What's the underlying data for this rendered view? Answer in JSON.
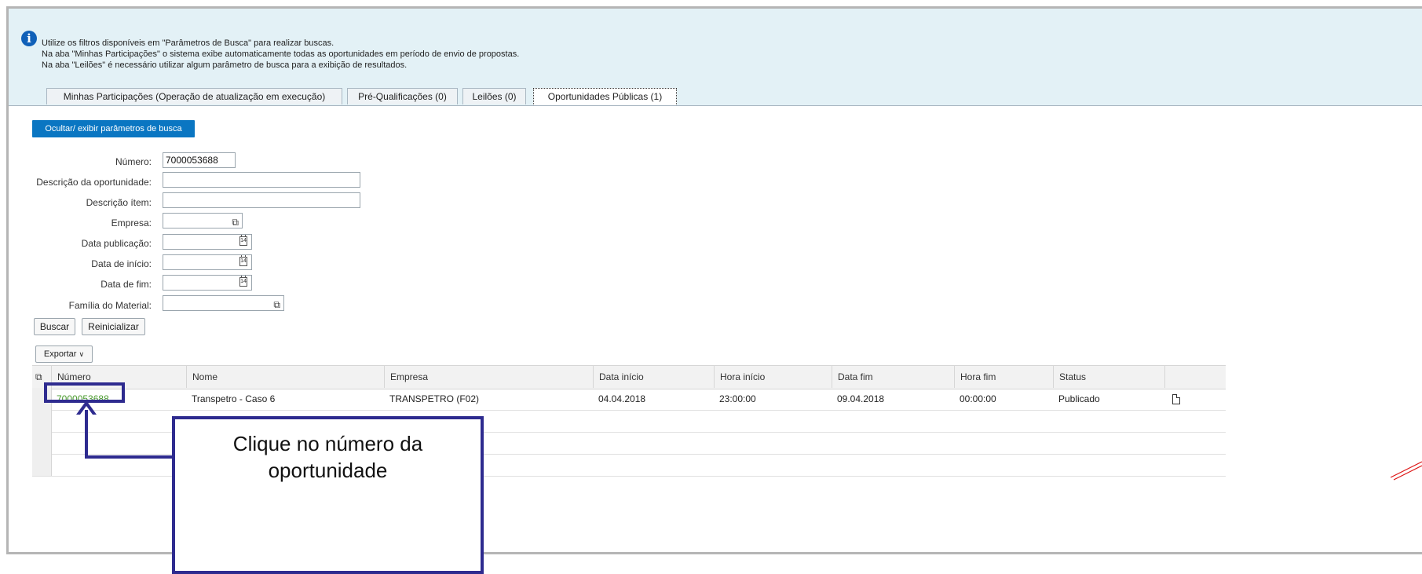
{
  "info": {
    "lines": [
      "Utilize os filtros disponíveis em \"Parâmetros de Busca\" para realizar buscas.",
      "Na aba \"Minhas Participações\" o sistema exibe automaticamente todas as oportunidades em período de envio de propostas.",
      "Na aba \"Leilões\" é necessário utilizar algum parâmetro de busca para a exibição de resultados."
    ]
  },
  "tabs": [
    {
      "label": "Minhas Participações (Operação de atualização em execução)",
      "active": false
    },
    {
      "label": "Pré-Qualificações (0)",
      "active": false
    },
    {
      "label": "Leilões (0)",
      "active": false
    },
    {
      "label": "Oportunidades Públicas (1)",
      "active": true
    }
  ],
  "toggle_button": "Ocultar/ exibir parâmetros de busca",
  "filters": {
    "numero": {
      "label": "Número:",
      "value": "7000053688"
    },
    "descricao_oportunidade": {
      "label": "Descrição da oportunidade:",
      "value": ""
    },
    "descricao_item": {
      "label": "Descrição ítem:",
      "value": ""
    },
    "empresa": {
      "label": "Empresa:",
      "value": "",
      "icon": "value-help-icon"
    },
    "data_publicacao": {
      "label": "Data publicação:",
      "value": "",
      "icon": "calendar-icon"
    },
    "data_inicio": {
      "label": "Data de início:",
      "value": "",
      "icon": "calendar-icon"
    },
    "data_fim": {
      "label": "Data de fim:",
      "value": "",
      "icon": "calendar-icon"
    },
    "familia_material": {
      "label": "Família do Material:",
      "value": "",
      "icon": "value-help-icon"
    }
  },
  "buttons": {
    "buscar": "Buscar",
    "reinicializar": "Reinicializar",
    "exportar": "Exportar"
  },
  "table": {
    "columns": [
      "Número",
      "Nome",
      "Empresa",
      "Data início",
      "Hora início",
      "Data fim",
      "Hora fim",
      "Status"
    ],
    "rows": [
      {
        "numero": "7000053688",
        "nome": "Transpetro - Caso 6",
        "empresa": "TRANSPETRO (F02)",
        "data_inicio": "04.04.2018",
        "hora_inicio": "23:00:00",
        "data_fim": "09.04.2018",
        "hora_fim": "00:00:00",
        "status": "Publicado"
      }
    ]
  },
  "callout": {
    "line1": "Clique no número da",
    "line2": "oportunidade"
  },
  "colors": {
    "accent_blue": "#0a76c2",
    "link_green": "#4a9b2d",
    "annotation": "#2e2b8f"
  }
}
